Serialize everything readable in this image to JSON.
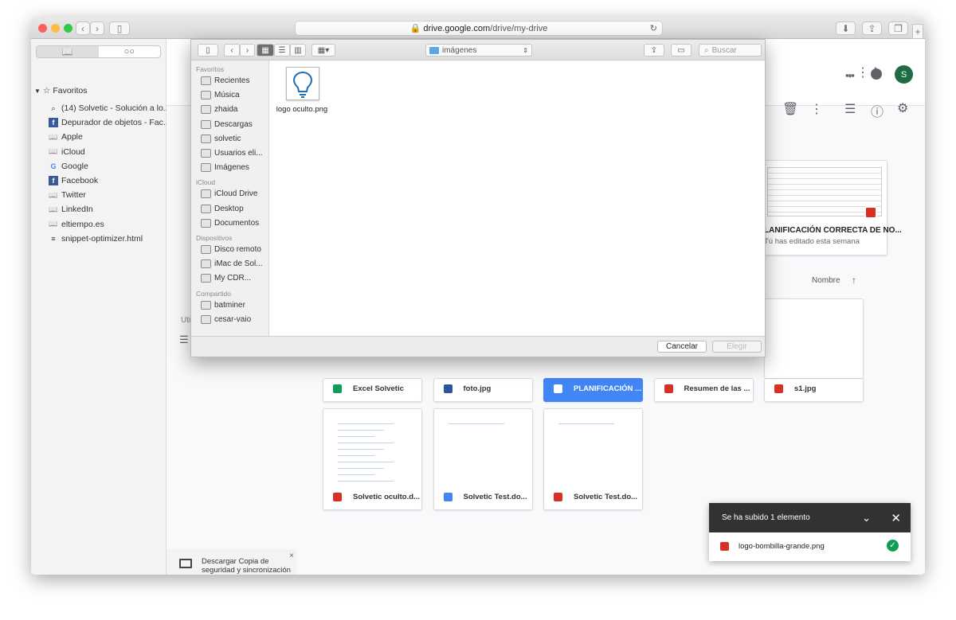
{
  "browser": {
    "url_host": "drive.google.com",
    "url_path": "/drive/my-drive"
  },
  "sidebar": {
    "section": "Favoritos",
    "items": [
      {
        "label": "(14) Solvetic - Solución a lo...",
        "icon": "search-icon"
      },
      {
        "label": "Depurador de objetos - Fac...",
        "icon": "facebook-icon"
      },
      {
        "label": "Apple",
        "icon": "book-icon"
      },
      {
        "label": "iCloud",
        "icon": "book-icon"
      },
      {
        "label": "Google",
        "icon": "google-icon"
      },
      {
        "label": "Facebook",
        "icon": "facebook-icon"
      },
      {
        "label": "Twitter",
        "icon": "book-icon"
      },
      {
        "label": "LinkedIn",
        "icon": "book-icon"
      },
      {
        "label": "eltiempo.es",
        "icon": "book-icon"
      },
      {
        "label": "snippet-optimizer.html",
        "icon": "code-icon"
      }
    ]
  },
  "dialog": {
    "location": "imágenes",
    "search_placeholder": "Buscar",
    "sections": [
      {
        "title": "Favoritos",
        "items": [
          "Recientes",
          "Música",
          "zhaida",
          "Descargas",
          "solvetic",
          "Usuarios eli...",
          "Imágenes"
        ]
      },
      {
        "title": "iCloud",
        "items": [
          "iCloud Drive",
          "Desktop",
          "Documentos"
        ]
      },
      {
        "title": "Dispositivos",
        "items": [
          "Disco remoto",
          "iMac de Sol...",
          "My CDR..."
        ]
      },
      {
        "title": "Compartido",
        "items": [
          "batminer",
          "cesar-vaio"
        ]
      }
    ],
    "file": {
      "name": "logo oculto.png"
    },
    "cancel": "Cancelar",
    "choose": "Elegir"
  },
  "drive": {
    "left_nav_fragment": "Util",
    "recent_card": {
      "title": "LANIFICACIÓN CORRECTA DE NO...",
      "subtitle": "Tú has editado esta semana"
    },
    "sort_label": "Nombre",
    "files_row1": [
      {
        "name": "Excel Solvetic",
        "type": "sheet",
        "color": "#0f9d58"
      },
      {
        "name": "foto.jpg",
        "type": "word",
        "color": "#2b579a"
      },
      {
        "name": "PLANIFICACIÓN ...",
        "type": "image",
        "color": "#d93025",
        "selected": true
      },
      {
        "name": "Resumen de las ...",
        "type": "slides",
        "color": "#d93025"
      },
      {
        "name": "s1.jpg",
        "type": "image",
        "color": "#d93025"
      }
    ],
    "files_row2": [
      {
        "name": "Solvetic oculto.d...",
        "type": "image",
        "color": "#d93025"
      },
      {
        "name": "Solvetic Test.do...",
        "type": "doc",
        "color": "#4285f4"
      },
      {
        "name": "Solvetic Test.do...",
        "type": "image",
        "color": "#d93025"
      }
    ],
    "promo": "Descargar Copia de seguridad y sincronización para Mac",
    "avatar_letter": "S"
  },
  "toast": {
    "title": "Se ha subido 1 elemento",
    "file": "logo-bombilla-grande.png"
  }
}
